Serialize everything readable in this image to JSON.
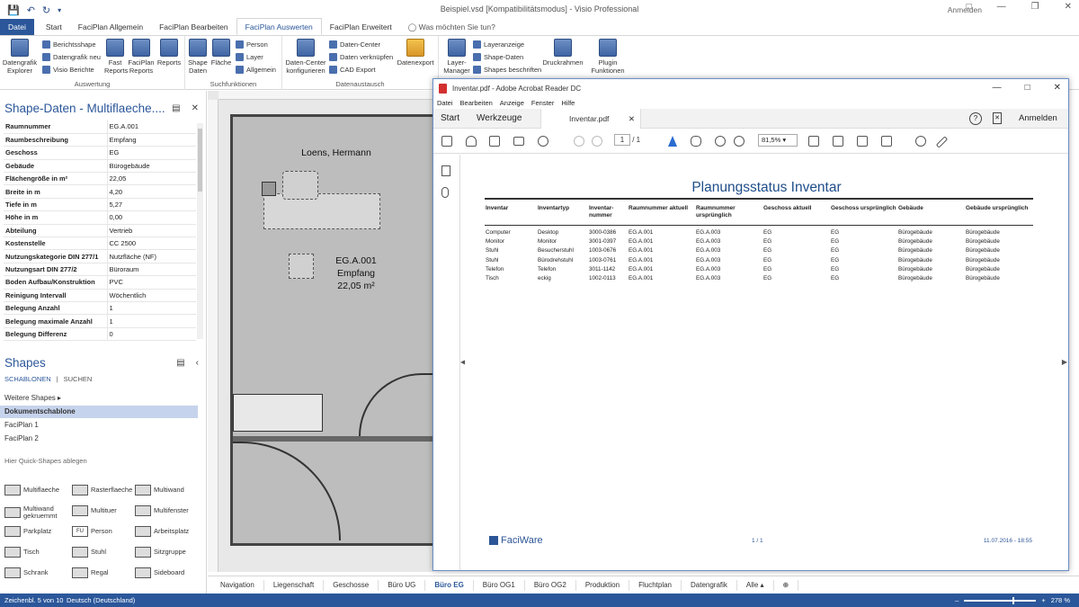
{
  "window": {
    "title": "Beispiel.vsd [Kompatibilitätsmodus] - Visio Professional",
    "account": "Anmelden"
  },
  "tabs": [
    "Datei",
    "Start",
    "FaciPlan Allgemein",
    "FaciPlan Bearbeiten",
    "FaciPlan Auswerten",
    "FaciPlan Erweitert"
  ],
  "tell_me": "Was möchten Sie tun?",
  "ribbon": {
    "auswertung": {
      "label": "Auswertung",
      "datengrafik_explorer": "Datengrafik Explorer",
      "berichtsshape": "Berichtsshape",
      "datengrafik_neu": "Datengrafik neu",
      "visio_berichte": "Visio Berichte",
      "fast_reports": "Fast Reports",
      "faciplan_reports": "FaciPlan Reports",
      "reports": "Reports"
    },
    "suchfunktionen": {
      "label": "Suchfunktionen",
      "shape_daten": "Shape Daten",
      "flaeche": "Fläche",
      "person": "Person",
      "layer": "Layer",
      "allgemein": "Allgemein"
    },
    "datenaustausch": {
      "label": "Datenaustausch",
      "datencenter_konfigurieren": "Daten-Center konfigurieren",
      "datencenter": "Daten-Center",
      "daten_verknuepfen": "Daten verknüpfen",
      "cad_export": "CAD Export",
      "datenexport": "Datenexport"
    },
    "other": {
      "layer_manager": "Layer-Manager",
      "layeranzeige": "Layeranzeige",
      "shape_daten": "Shape-Daten",
      "shapes_beschriften": "Shapes beschriften",
      "druckrahmen": "Druckrahmen",
      "plugin_funktionen": "Plugin Funktionen"
    }
  },
  "shape_data": {
    "title": "Shape-Daten - Multiflaeche....",
    "rows": [
      {
        "k": "Raumnummer",
        "v": "EG.A.001"
      },
      {
        "k": "Raumbeschreibung",
        "v": "Empfang"
      },
      {
        "k": "Geschoss",
        "v": "EG"
      },
      {
        "k": "Gebäude",
        "v": "Bürogebäude"
      },
      {
        "k": "Flächengröße in m²",
        "v": "22,05"
      },
      {
        "k": "Breite in m",
        "v": "4,20"
      },
      {
        "k": "Tiefe in m",
        "v": "5,27"
      },
      {
        "k": "Höhe in m",
        "v": "0,00"
      },
      {
        "k": "Abteilung",
        "v": "Vertrieb"
      },
      {
        "k": "Kostenstelle",
        "v": "CC 2500"
      },
      {
        "k": "Nutzungskategorie DIN 277/1",
        "v": "Nutzfläche (NF)"
      },
      {
        "k": "Nutzungsart DIN 277/2",
        "v": "Büroraum"
      },
      {
        "k": "Boden Aufbau/Konstruktion",
        "v": "PVC"
      },
      {
        "k": "Reinigung Intervall",
        "v": "Wöchentlich"
      },
      {
        "k": "Belegung Anzahl",
        "v": "1"
      },
      {
        "k": "Belegung maximale Anzahl",
        "v": "1"
      },
      {
        "k": "Belegung Differenz",
        "v": "0"
      }
    ]
  },
  "shapes_panel": {
    "title": "Shapes",
    "tab_schablonen": "SCHABLONEN",
    "tab_suchen": "SUCHEN",
    "weitere": "Weitere Shapes",
    "stencils": [
      "Dokumentschablone",
      "FaciPlan 1",
      "FaciPlan 2"
    ],
    "hint": "Hier Quick-Shapes ablegen",
    "items": [
      "Multiflaeche",
      "Rasterflaeche",
      "Multiwand",
      "Multiwand gekruemmt",
      "Multituer",
      "Multifenster",
      "Parkplatz",
      "Person",
      "Arbeitsplatz",
      "Tisch",
      "Stuhl",
      "Sitzgruppe",
      "Schrank",
      "Regal",
      "Sideboard"
    ],
    "person_badge": "FU"
  },
  "canvas": {
    "person_name": "Loens, Hermann",
    "room_number": "EG.A.001",
    "room_desc": "Empfang",
    "room_area": "22,05 m²"
  },
  "sheets": [
    "Navigation",
    "Liegenschaft",
    "Geschosse",
    "Büro UG",
    "Büro EG",
    "Büro OG1",
    "Büro OG2",
    "Produktion",
    "Fluchtplan",
    "Datengrafik",
    "Alle ▴"
  ],
  "status": {
    "sheet": "Zeichenbl. 5 von 10",
    "lang": "Deutsch (Deutschland)",
    "zoom": "278 %"
  },
  "acrobat": {
    "title": "Inventar.pdf - Adobe Acrobat Reader DC",
    "menu": [
      "Datei",
      "Bearbeiten",
      "Anzeige",
      "Fenster",
      "Hilfe"
    ],
    "tab_start": "Start",
    "tab_werkzeuge": "Werkzeuge",
    "doc_tab": "Inventar.pdf",
    "signin": "Anmelden",
    "page_current": "1",
    "page_total": "/ 1",
    "zoom": "81,5%",
    "doc": {
      "title": "Planungsstatus Inventar",
      "headers": [
        "Inventar",
        "Inventartyp",
        "Inventar-nummer",
        "Raumnummer aktuell",
        "Raumnummer ursprünglich",
        "Geschoss aktuell",
        "Geschoss ursprünglich",
        "Gebäude",
        "Gebäude ursprünglich"
      ],
      "rows": [
        [
          "Computer",
          "Desktop",
          "3000-0386",
          "EG.A.001",
          "EG.A.003",
          "EG",
          "EG",
          "Bürogebäude",
          "Bürogebäude"
        ],
        [
          "Monitor",
          "Monitor",
          "3001-0397",
          "EG.A.001",
          "EG.A.003",
          "EG",
          "EG",
          "Bürogebäude",
          "Bürogebäude"
        ],
        [
          "Stuhl",
          "Besucherstuhl",
          "1003-0676",
          "EG.A.001",
          "EG.A.003",
          "EG",
          "EG",
          "Bürogebäude",
          "Bürogebäude"
        ],
        [
          "Stuhl",
          "Bürodrehstuhl",
          "1003-0761",
          "EG.A.001",
          "EG.A.003",
          "EG",
          "EG",
          "Bürogebäude",
          "Bürogebäude"
        ],
        [
          "Telefon",
          "Telefon",
          "3011-1142",
          "EG.A.001",
          "EG.A.003",
          "EG",
          "EG",
          "Bürogebäude",
          "Bürogebäude"
        ],
        [
          "Tisch",
          "eckig",
          "1002-0113",
          "EG.A.001",
          "EG.A.003",
          "EG",
          "EG",
          "Bürogebäude",
          "Bürogebäude"
        ]
      ],
      "logo": "FaciWare",
      "footer_page": "1 / 1",
      "footer_date": "11.07.2016 - 18:55"
    }
  }
}
